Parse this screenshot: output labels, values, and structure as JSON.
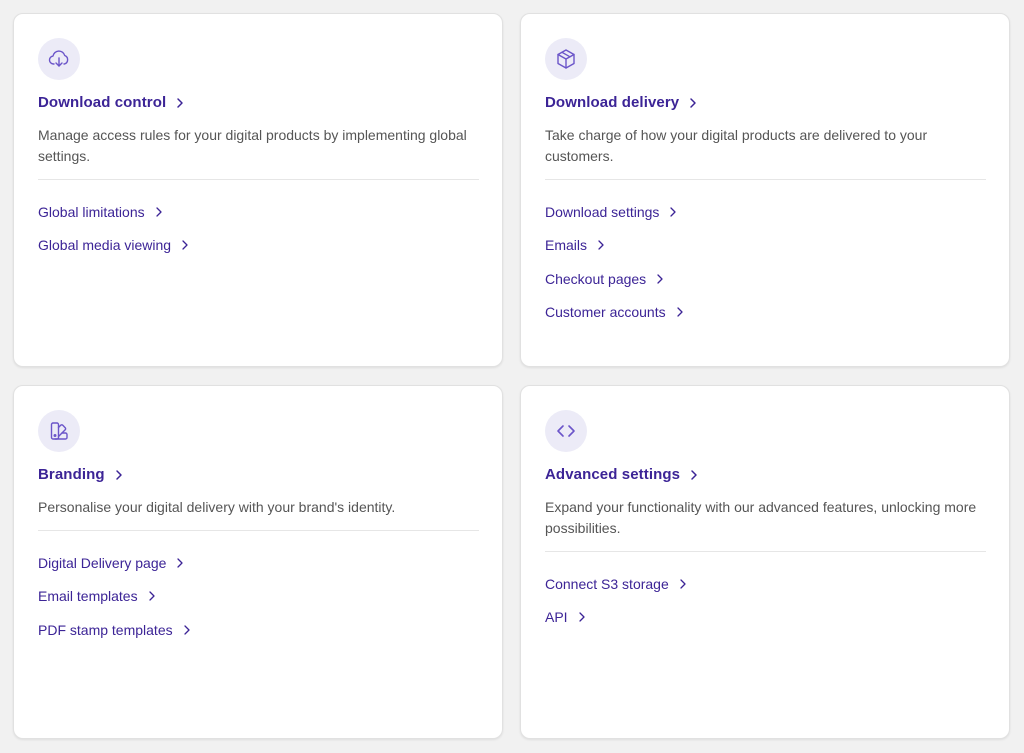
{
  "cards": [
    {
      "icon": "cloud-download-icon",
      "title": "Download control",
      "description": "Manage access rules for your digital products by implementing global settings.",
      "links": [
        "Global limitations",
        "Global media viewing"
      ]
    },
    {
      "icon": "cube-icon",
      "title": "Download delivery",
      "description": "Take charge of how your digital products are delivered to your customers.",
      "links": [
        "Download settings",
        "Emails",
        "Checkout pages",
        "Customer accounts"
      ]
    },
    {
      "icon": "palette-icon",
      "title": "Branding",
      "description": "Personalise your digital delivery with your brand's identity.",
      "links": [
        "Digital Delivery page",
        "Email templates",
        "PDF stamp templates"
      ]
    },
    {
      "icon": "code-icon",
      "title": "Advanced settings",
      "description": "Expand your functionality with our advanced features, unlocking more possibilities.",
      "links": [
        "Connect S3 storage",
        "API"
      ]
    }
  ],
  "colors": {
    "accent": "#3c2496",
    "icon_bg": "#ecebf7",
    "icon_stroke": "#6b55c9",
    "text_muted": "#555555",
    "page_bg": "#f1f1f1"
  }
}
